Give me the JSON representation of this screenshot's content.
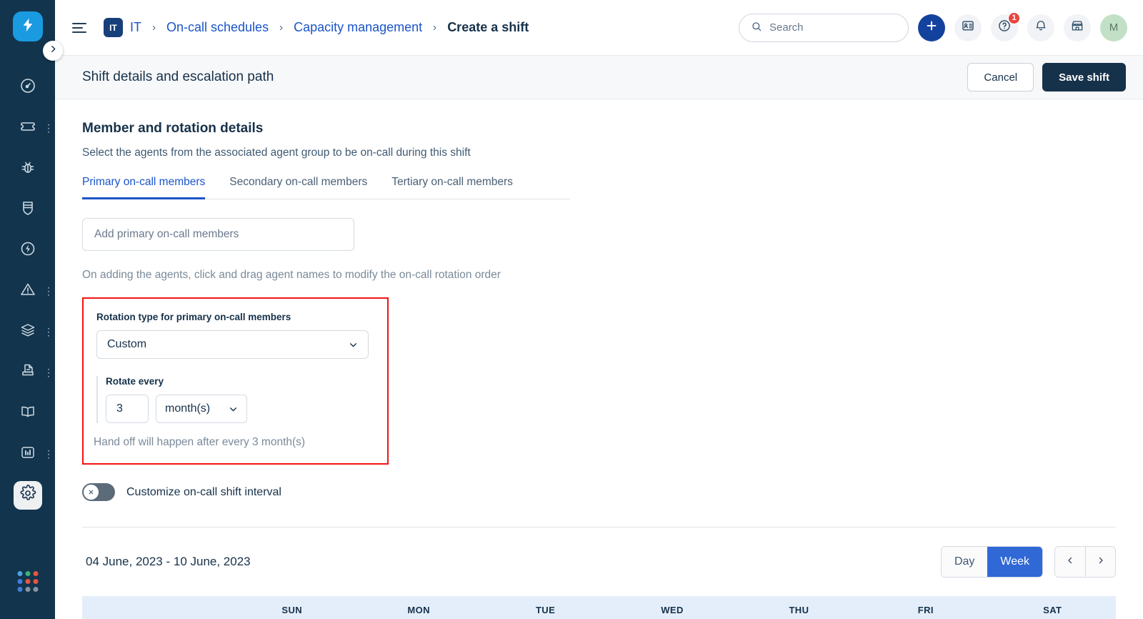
{
  "sidebar": {
    "logo_icon": "lightning-bolt-logo",
    "expand_icon": "chevron-right-icon",
    "items": [
      {
        "icon": "dashboard-gauge-icon",
        "name": "dashboard",
        "has_menu": false,
        "active": false
      },
      {
        "icon": "ticket-icon",
        "name": "tickets",
        "has_menu": true,
        "active": false
      },
      {
        "icon": "bug-icon",
        "name": "bugs",
        "has_menu": false,
        "active": false
      },
      {
        "icon": "shield-icon",
        "name": "security",
        "has_menu": false,
        "active": false
      },
      {
        "icon": "lightning-circle-icon",
        "name": "changes",
        "has_menu": false,
        "active": false
      },
      {
        "icon": "warning-triangle-icon",
        "name": "problems",
        "has_menu": true,
        "active": false
      },
      {
        "icon": "layers-icon",
        "name": "assets",
        "has_menu": true,
        "active": false
      },
      {
        "icon": "release-document-icon",
        "name": "releases",
        "has_menu": true,
        "active": false
      },
      {
        "icon": "book-icon",
        "name": "knowledge-base",
        "has_menu": false,
        "active": false
      },
      {
        "icon": "bar-chart-icon",
        "name": "analytics",
        "has_menu": true,
        "active": false
      },
      {
        "icon": "gear-icon",
        "name": "admin-settings",
        "has_menu": false,
        "active": true
      }
    ],
    "app_switcher_icon": "dot-grid-icon",
    "dot_colors": [
      "#4aa3e0",
      "#3cb371",
      "#e8553f",
      "#3f7fd6",
      "#e8553f",
      "#e8553f",
      "#3f7fd6",
      "#8894a3",
      "#8894a3"
    ],
    "background": "#12344d"
  },
  "topbar": {
    "menu_icon": "hamburger-menu-icon",
    "workspace_badge": "IT",
    "breadcrumb": [
      {
        "label": "IT",
        "type": "link"
      },
      {
        "label": "On-call schedules",
        "type": "link"
      },
      {
        "label": "Capacity management",
        "type": "link"
      },
      {
        "label": "Create a shift",
        "type": "current"
      }
    ],
    "search": {
      "placeholder": "Search",
      "icon": "search-icon"
    },
    "actions": [
      {
        "icon": "plus-icon",
        "name": "create-new-button",
        "style": "primary",
        "badge": null
      },
      {
        "icon": "contact-card-icon",
        "name": "contacts-button",
        "style": "default",
        "badge": null
      },
      {
        "icon": "help-question-icon",
        "name": "help-button",
        "style": "default",
        "badge": "1"
      },
      {
        "icon": "bell-icon",
        "name": "notifications-button",
        "style": "default",
        "badge": null
      },
      {
        "icon": "marketplace-storefront-icon",
        "name": "marketplace-button",
        "style": "default",
        "badge": null
      }
    ],
    "avatar_initial": "M",
    "avatar_color": "#c2e0c6"
  },
  "page_header": {
    "title": "Shift details and escalation path",
    "cancel_label": "Cancel",
    "save_label": "Save shift"
  },
  "content": {
    "section_title": "Member and rotation details",
    "section_subtitle": "Select the agents from the associated agent group to be on-call during this shift",
    "tabs": [
      {
        "label": "Primary on-call members",
        "active": true
      },
      {
        "label": "Secondary on-call members",
        "active": false
      },
      {
        "label": "Tertiary on-call members",
        "active": false
      }
    ],
    "member_input_placeholder": "Add primary on-call members",
    "drag_hint": "On adding the agents, click and drag agent names to modify the on-call rotation order",
    "rotation": {
      "highlight_color": "#f31414",
      "label": "Rotation type for primary on-call members",
      "selected_type": "Custom",
      "rotate_every_label": "Rotate every",
      "interval_value": "3",
      "interval_unit": "month(s)",
      "handoff_text": "Hand off will happen after every 3 month(s)",
      "chevron_icon": "chevron-down-icon"
    },
    "toggle": {
      "label": "Customize on-call shift interval",
      "state": "off",
      "knob_icon": "close-x-icon"
    }
  },
  "calendar": {
    "date_range": "04 June, 2023 - 10 June, 2023",
    "view_options": [
      {
        "label": "Day",
        "active": false
      },
      {
        "label": "Week",
        "active": true
      }
    ],
    "prev_icon": "chevron-left-icon",
    "next_icon": "chevron-right-icon",
    "day_headers": [
      "SUN",
      "MON",
      "TUE",
      "WED",
      "THU",
      "FRI",
      "SAT"
    ],
    "header_background": "#e4eefb",
    "active_view_color": "#3068d6"
  }
}
